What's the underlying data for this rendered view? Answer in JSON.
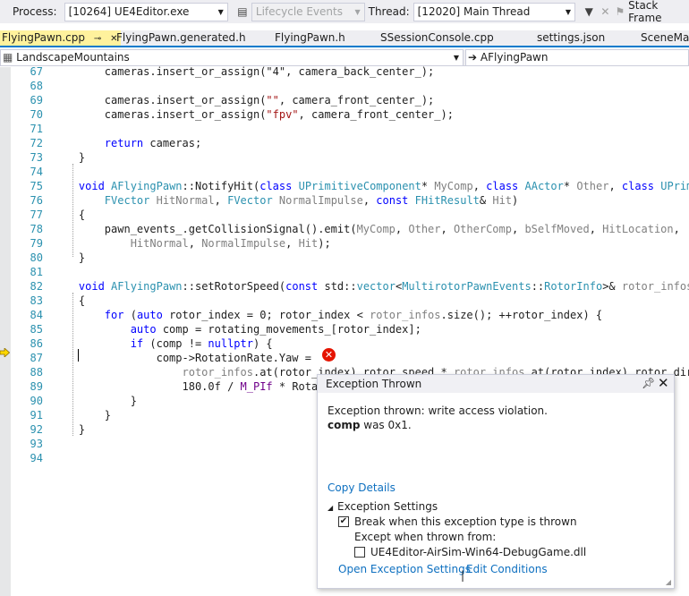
{
  "toolbar": {
    "process_label": "Process:",
    "process_value": "[10264] UE4Editor.exe",
    "lifecycle_label": "Lifecycle Events",
    "thread_label": "Thread:",
    "thread_value": "[12020] Main Thread",
    "stack_frame_label": "Stack Frame"
  },
  "tabs": [
    {
      "label": "FlyingPawn.cpp",
      "active": true
    },
    {
      "label": "FlyingPawn.generated.h",
      "active": false
    },
    {
      "label": "FlyingPawn.h",
      "active": false
    },
    {
      "label": "SSessionConsole.cpp",
      "active": false
    },
    {
      "label": "settings.json",
      "active": false
    },
    {
      "label": "SceneMan",
      "active": false
    }
  ],
  "navbar": {
    "project": "LandscapeMountains",
    "scope": "AFlyingPawn"
  },
  "code_lines": [
    {
      "n": "67",
      "tokens": [
        [
          "",
          "        cameras.insert_or_assign(\"4\", camera_back_center_);"
        ]
      ]
    },
    {
      "n": "68",
      "tokens": []
    },
    {
      "n": "69",
      "tokens": [
        [
          "",
          "        cameras.insert_or_assign("
        ],
        [
          "st",
          "\"\""
        ],
        [
          "",
          ", camera_front_center_);"
        ]
      ]
    },
    {
      "n": "70",
      "tokens": [
        [
          "",
          "        cameras.insert_or_assign("
        ],
        [
          "st",
          "\"fpv\""
        ],
        [
          "",
          ", camera_front_center_);"
        ]
      ]
    },
    {
      "n": "71",
      "tokens": []
    },
    {
      "n": "72",
      "tokens": [
        [
          "",
          "        "
        ],
        [
          "kw",
          "return"
        ],
        [
          "",
          " cameras;"
        ]
      ]
    },
    {
      "n": "73",
      "tokens": [
        [
          "",
          "    }"
        ]
      ]
    },
    {
      "n": "74",
      "tokens": []
    },
    {
      "n": "75",
      "tokens": [
        [
          "",
          "    "
        ],
        [
          "kw",
          "void"
        ],
        [
          "",
          " "
        ],
        [
          "ty",
          "AFlyingPawn"
        ],
        [
          "",
          "::NotifyHit("
        ],
        [
          "kw",
          "class"
        ],
        [
          "",
          " "
        ],
        [
          "ty",
          "UPrimitiveComponent"
        ],
        [
          "",
          "* "
        ],
        [
          "pa",
          "MyComp"
        ],
        [
          "",
          ", "
        ],
        [
          "kw",
          "class"
        ],
        [
          "",
          " "
        ],
        [
          "ty",
          "AActor"
        ],
        [
          "",
          "* "
        ],
        [
          "pa",
          "Other"
        ],
        [
          "",
          ", "
        ],
        [
          "kw",
          "class"
        ],
        [
          "",
          " "
        ],
        [
          "ty",
          "UPrimiti"
        ]
      ]
    },
    {
      "n": "76",
      "tokens": [
        [
          "",
          "        "
        ],
        [
          "ty",
          "FVector"
        ],
        [
          "",
          " "
        ],
        [
          "pa",
          "HitNormal"
        ],
        [
          "",
          ", "
        ],
        [
          "ty",
          "FVector"
        ],
        [
          "",
          " "
        ],
        [
          "pa",
          "NormalImpulse"
        ],
        [
          "",
          ", "
        ],
        [
          "kw",
          "const"
        ],
        [
          "",
          " "
        ],
        [
          "ty",
          "FHitResult"
        ],
        [
          "",
          "& "
        ],
        [
          "pa",
          "Hit"
        ],
        [
          "",
          ")"
        ]
      ]
    },
    {
      "n": "77",
      "tokens": [
        [
          "",
          "    {"
        ]
      ]
    },
    {
      "n": "78",
      "tokens": [
        [
          "",
          "        pawn_events_.getCollisionSignal().emit("
        ],
        [
          "pa",
          "MyComp"
        ],
        [
          "",
          ", "
        ],
        [
          "pa",
          "Other"
        ],
        [
          "",
          ", "
        ],
        [
          "pa",
          "OtherComp"
        ],
        [
          "",
          ", "
        ],
        [
          "pa",
          "bSelfMoved"
        ],
        [
          "",
          ", "
        ],
        [
          "pa",
          "HitLocation"
        ],
        [
          "",
          ","
        ]
      ]
    },
    {
      "n": "79",
      "tokens": [
        [
          "",
          "            "
        ],
        [
          "pa",
          "HitNormal"
        ],
        [
          "",
          ", "
        ],
        [
          "pa",
          "NormalImpulse"
        ],
        [
          "",
          ", "
        ],
        [
          "pa",
          "Hit"
        ],
        [
          "",
          ");"
        ]
      ]
    },
    {
      "n": "80",
      "tokens": [
        [
          "",
          "    }"
        ]
      ]
    },
    {
      "n": "81",
      "tokens": []
    },
    {
      "n": "82",
      "tokens": [
        [
          "",
          "    "
        ],
        [
          "kw",
          "void"
        ],
        [
          "",
          " "
        ],
        [
          "ty",
          "AFlyingPawn"
        ],
        [
          "",
          "::setRotorSpeed("
        ],
        [
          "kw",
          "const"
        ],
        [
          "",
          " std::"
        ],
        [
          "ty",
          "vector"
        ],
        [
          "",
          "<"
        ],
        [
          "ty",
          "MultirotorPawnEvents"
        ],
        [
          "",
          "::"
        ],
        [
          "ty",
          "RotorInfo"
        ],
        [
          "",
          ">& "
        ],
        [
          "pa",
          "rotor_infos"
        ],
        [
          "",
          ")"
        ]
      ]
    },
    {
      "n": "83",
      "tokens": [
        [
          "",
          "    {"
        ]
      ]
    },
    {
      "n": "84",
      "tokens": [
        [
          "",
          "        "
        ],
        [
          "kw",
          "for"
        ],
        [
          "",
          " ("
        ],
        [
          "kw",
          "auto"
        ],
        [
          "",
          " rotor_index = 0; rotor_index < "
        ],
        [
          "pa",
          "rotor_infos"
        ],
        [
          "",
          ".size(); ++rotor_index) {"
        ]
      ]
    },
    {
      "n": "85",
      "tokens": [
        [
          "",
          "            "
        ],
        [
          "kw",
          "auto"
        ],
        [
          "",
          " comp = rotating_movements_[rotor_index];"
        ]
      ]
    },
    {
      "n": "86",
      "tokens": [
        [
          "",
          "            "
        ],
        [
          "kw",
          "if"
        ],
        [
          "",
          " (comp != "
        ],
        [
          "kw",
          "nullptr"
        ],
        [
          "",
          ") {"
        ]
      ]
    },
    {
      "n": "87",
      "tokens": [
        [
          "",
          "                comp->RotationRate.Yaw ="
        ]
      ]
    },
    {
      "n": "88",
      "tokens": [
        [
          "",
          "                    "
        ],
        [
          "pa",
          "rotor_infos"
        ],
        [
          "",
          ".at(rotor_index).rotor_speed * "
        ],
        [
          "pa",
          "rotor_infos"
        ],
        [
          "",
          ".at(rotor_index).rotor_direct"
        ]
      ]
    },
    {
      "n": "89",
      "tokens": [
        [
          "",
          "                    180.0f / "
        ],
        [
          "mac",
          "M_PIf"
        ],
        [
          "",
          " * Rotat"
        ]
      ]
    },
    {
      "n": "90",
      "tokens": [
        [
          "",
          "            }"
        ]
      ]
    },
    {
      "n": "91",
      "tokens": [
        [
          "",
          "        }"
        ]
      ]
    },
    {
      "n": "92",
      "tokens": [
        [
          "",
          "    }"
        ]
      ]
    },
    {
      "n": "93",
      "tokens": []
    },
    {
      "n": "94",
      "tokens": []
    }
  ],
  "popup": {
    "title": "Exception Thrown",
    "message_line1": "Exception thrown: write access violation.",
    "message_var": "comp",
    "message_rest": " was 0x1.",
    "copy_details": "Copy Details",
    "settings_title": "Exception Settings",
    "break_label": "Break when this exception type is thrown",
    "break_checked": true,
    "except_label": "Except when thrown from:",
    "module_label": "UE4Editor-AirSim-Win64-DebugGame.dll",
    "module_checked": false,
    "open_settings": "Open Exception Settings",
    "separator": "|",
    "edit_conditions": "Edit Conditions"
  }
}
